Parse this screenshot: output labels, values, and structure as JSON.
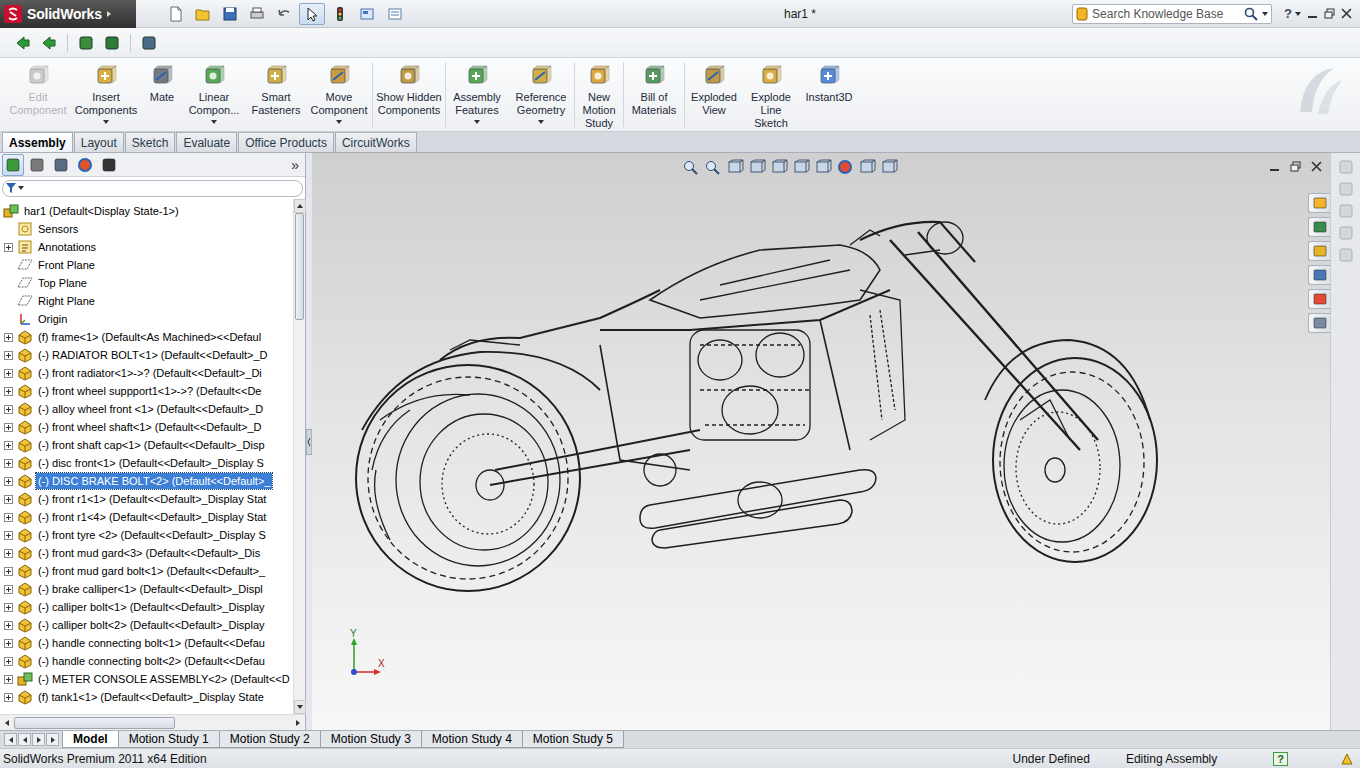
{
  "app": {
    "logo": "SolidWorks",
    "title": "har1 *"
  },
  "search": {
    "placeholder": "Search Knowledge Base"
  },
  "help": "?",
  "ribbon": [
    {
      "buttons": [
        {
          "label": "Edit Component",
          "disabled": true,
          "dropdown": false
        },
        {
          "label": "Insert Components",
          "disabled": false,
          "dropdown": true
        },
        {
          "label": "Mate",
          "disabled": false,
          "dropdown": false
        },
        {
          "label": "Linear Compon...",
          "disabled": false,
          "dropdown": true
        },
        {
          "label": "Smart Fasteners",
          "disabled": false,
          "dropdown": false
        },
        {
          "label": "Move Component",
          "disabled": false,
          "dropdown": true
        }
      ]
    },
    {
      "buttons": [
        {
          "label": "Show Hidden Components",
          "disabled": false,
          "dropdown": false
        }
      ]
    },
    {
      "buttons": [
        {
          "label": "Assembly Features",
          "disabled": false,
          "dropdown": true
        },
        {
          "label": "Reference Geometry",
          "disabled": false,
          "dropdown": true
        }
      ]
    },
    {
      "buttons": [
        {
          "label": "New Motion Study",
          "disabled": false,
          "dropdown": false
        }
      ]
    },
    {
      "buttons": [
        {
          "label": "Bill of Materials",
          "disabled": false,
          "dropdown": false
        }
      ]
    },
    {
      "buttons": [
        {
          "label": "Exploded View",
          "disabled": false,
          "dropdown": false
        },
        {
          "label": "Explode Line Sketch",
          "disabled": false,
          "dropdown": false
        },
        {
          "label": "Instant3D",
          "disabled": false,
          "dropdown": false
        }
      ]
    }
  ],
  "command_tabs": [
    {
      "label": "Assembly",
      "selected": true
    },
    {
      "label": "Layout",
      "selected": false
    },
    {
      "label": "Sketch",
      "selected": false
    },
    {
      "label": "Evaluate",
      "selected": false
    },
    {
      "label": "Office Products",
      "selected": false
    },
    {
      "label": "CircuitWorks",
      "selected": false
    }
  ],
  "panel": {
    "more": "»"
  },
  "tree": {
    "root": "har1  (Default<Display State-1>)",
    "scroll": {
      "v_pos": 0,
      "v_size": 0.22,
      "h_pos": 0,
      "h_size": 0.58
    },
    "items": [
      {
        "label": "Sensors",
        "kind": "sensors",
        "expandable": false,
        "selected": false
      },
      {
        "label": "Annotations",
        "kind": "annotations",
        "expandable": true,
        "selected": false
      },
      {
        "label": "Front Plane",
        "kind": "plane",
        "expandable": false,
        "selected": false
      },
      {
        "label": "Top Plane",
        "kind": "plane",
        "expandable": false,
        "selected": false
      },
      {
        "label": "Right Plane",
        "kind": "plane",
        "expandable": false,
        "selected": false
      },
      {
        "label": "Origin",
        "kind": "origin",
        "expandable": false,
        "selected": false
      },
      {
        "label": "(f) frame<1> (Default<As Machined><<Defaul",
        "kind": "part",
        "expandable": true,
        "selected": false
      },
      {
        "label": "(-) RADIATOR BOLT<1> (Default<<Default>_D",
        "kind": "part",
        "expandable": true,
        "selected": false
      },
      {
        "label": "(-) front radiator<1>->? (Default<<Default>_Di",
        "kind": "part",
        "expandable": true,
        "selected": false
      },
      {
        "label": "(-) front wheel suppport1<1>->? (Default<<De",
        "kind": "part",
        "expandable": true,
        "selected": false
      },
      {
        "label": "(-) alloy wheel front <1> (Default<<Default>_D",
        "kind": "part",
        "expandable": true,
        "selected": false
      },
      {
        "label": "(-) front wheel shaft<1> (Default<<Default>_D",
        "kind": "part",
        "expandable": true,
        "selected": false
      },
      {
        "label": "(-) front shaft cap<1> (Default<<Default>_Disp",
        "kind": "part",
        "expandable": true,
        "selected": false
      },
      {
        "label": "(-) disc front<1> (Default<<Default>_Display S",
        "kind": "part",
        "expandable": true,
        "selected": false
      },
      {
        "label": "(-) DISC BRAKE BOLT<2> (Default<<Default>_",
        "kind": "part",
        "expandable": true,
        "selected": true
      },
      {
        "label": "(-) front r1<1> (Default<<Default>_Display Stat",
        "kind": "part",
        "expandable": true,
        "selected": false
      },
      {
        "label": "(-) front r1<4> (Default<<Default>_Display Stat",
        "kind": "part",
        "expandable": true,
        "selected": false
      },
      {
        "label": "(-) front tyre  <2> (Default<<Default>_Display S",
        "kind": "part",
        "expandable": true,
        "selected": false
      },
      {
        "label": "(-) front mud gard<3> (Default<<Default>_Dis",
        "kind": "part",
        "expandable": true,
        "selected": false
      },
      {
        "label": "(-) front mud gard bolt<1> (Default<<Default>_",
        "kind": "part",
        "expandable": true,
        "selected": false
      },
      {
        "label": "(-) brake calliper<1> (Default<<Default>_Displ",
        "kind": "part",
        "expandable": true,
        "selected": false
      },
      {
        "label": "(-) calliper bolt<1> (Default<<Default>_Display",
        "kind": "part",
        "expandable": true,
        "selected": false
      },
      {
        "label": "(-) calliper bolt<2> (Default<<Default>_Display",
        "kind": "part",
        "expandable": true,
        "selected": false
      },
      {
        "label": "(-) handle connecting bolt<1> (Default<<Defau",
        "kind": "part",
        "expandable": true,
        "selected": false
      },
      {
        "label": "(-) handle connecting bolt<2> (Default<<Defau",
        "kind": "part",
        "expandable": true,
        "selected": false
      },
      {
        "label": "(-) METER CONSOLE ASSEMBLY<2> (Default<<D",
        "kind": "assembly",
        "expandable": true,
        "selected": false
      },
      {
        "label": "(f) tank1<1> (Default<<Default>_Display State",
        "kind": "part",
        "expandable": true,
        "selected": false
      }
    ]
  },
  "triad": {
    "y": "Y",
    "x": "X"
  },
  "bottom_tabs": [
    {
      "label": "Model",
      "selected": true
    },
    {
      "label": "Motion Study 1",
      "selected": false
    },
    {
      "label": "Motion Study 2",
      "selected": false
    },
    {
      "label": "Motion Study 3",
      "selected": false
    },
    {
      "label": "Motion Study 4",
      "selected": false
    },
    {
      "label": "Motion Study 5",
      "selected": false
    }
  ],
  "status_bar": {
    "edition": "SolidWorks Premium 2011 x64 Edition",
    "state": "Under Defined",
    "mode": "Editing Assembly",
    "help": "?"
  }
}
